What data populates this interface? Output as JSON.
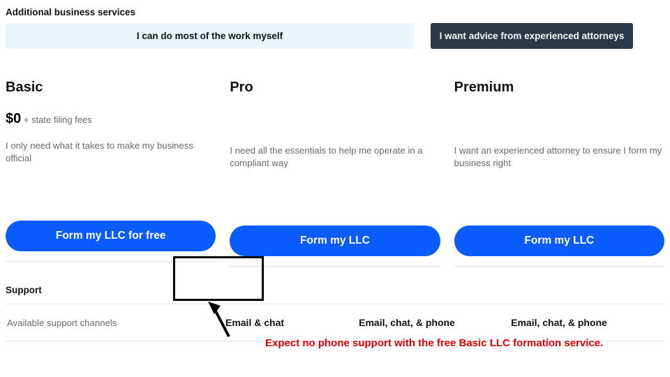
{
  "section_title": "Additional business services",
  "tabs": {
    "diy": "I can do most of the work myself",
    "attorney": "I want advice from experienced attorneys"
  },
  "plans": {
    "basic": {
      "name": "Basic",
      "price_amount": "$0",
      "price_suffix": " + state filing fees",
      "blurb": "I only need what it takes to make my business official",
      "cta": "Form my LLC for free"
    },
    "pro": {
      "name": "Pro",
      "blurb": "I need all the essentials to help me operate in a compliant way",
      "cta": "Form my LLC"
    },
    "premium": {
      "name": "Premium",
      "blurb": "I want an experienced attorney to ensure I form my business right",
      "cta": "Form my LLC"
    }
  },
  "support": {
    "heading": "Support",
    "row_label": "Available support channels",
    "basic": "Email & chat",
    "pro": "Email, chat, & phone",
    "premium": "Email, chat, & phone"
  },
  "annotation": "Expect no phone support with the free Basic LLC formation service."
}
